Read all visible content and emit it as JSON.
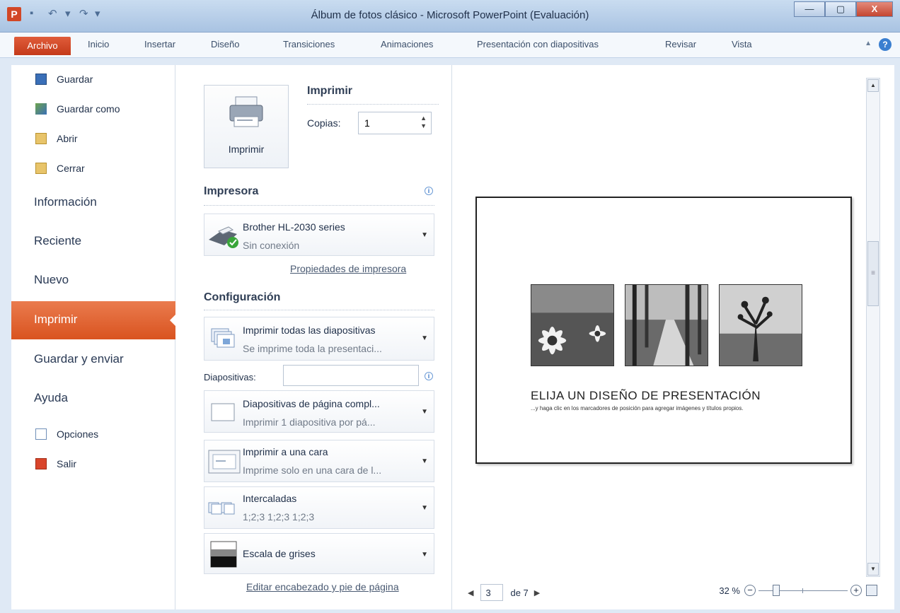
{
  "window": {
    "title": "Álbum de fotos clásico - Microsoft PowerPoint (Evaluación)",
    "app_icon": "P",
    "minimize": "—",
    "maximize": "▢",
    "close": "X"
  },
  "ribbon": {
    "tabs": [
      "Archivo",
      "Inicio",
      "Insertar",
      "Diseño",
      "Transiciones",
      "Animaciones",
      "Presentación con diapositivas",
      "Revisar",
      "Vista"
    ],
    "help": "?"
  },
  "nav": {
    "items_small_top": [
      {
        "label": "Guardar",
        "icon": "save-icon"
      },
      {
        "label": "Guardar como",
        "icon": "save-as-icon"
      },
      {
        "label": "Abrir",
        "icon": "open-folder-icon"
      },
      {
        "label": "Cerrar",
        "icon": "close-folder-icon"
      }
    ],
    "items_big": [
      "Información",
      "Reciente",
      "Nuevo"
    ],
    "selected": "Imprimir",
    "items_big_after": [
      "Guardar y enviar",
      "Ayuda"
    ],
    "items_small_bottom": [
      {
        "label": "Opciones",
        "icon": "options-icon"
      },
      {
        "label": "Salir",
        "icon": "exit-icon"
      }
    ]
  },
  "print": {
    "button_label": "Imprimir",
    "section_title": "Imprimir",
    "copies_label": "Copias:",
    "copies_value": "1",
    "printer_section": "Impresora",
    "printer_name": "Brother HL-2030 series",
    "printer_status": "Sin conexión",
    "printer_properties": "Propiedades de impresora",
    "settings_section": "Configuración",
    "settings": [
      {
        "title": "Imprimir todas las diapositivas",
        "subtitle": "Se imprime toda la presentaci..."
      },
      {
        "title": "Diapositivas de página compl...",
        "subtitle": "Imprimir 1 diapositiva por pá..."
      },
      {
        "title": "Imprimir a una cara",
        "subtitle": "Imprime solo en una cara de l..."
      },
      {
        "title": "Intercaladas",
        "subtitle": "1;2;3   1;2;3   1;2;3"
      },
      {
        "title": "Escala de grises",
        "subtitle": ""
      }
    ],
    "slides_label": "Diapositivas:",
    "slides_value": "",
    "edit_header_footer": "Editar encabezado y pie de página"
  },
  "preview": {
    "slide_title": "ELIJA UN DISEÑO DE PRESENTACIÓN",
    "slide_subtitle": "...y haga clic en los marcadores de posición para agregar imágenes y títulos propios.",
    "current_page": "3",
    "total_pages": "de 7",
    "zoom": "32 %",
    "zoom_fraction": 0.32
  }
}
